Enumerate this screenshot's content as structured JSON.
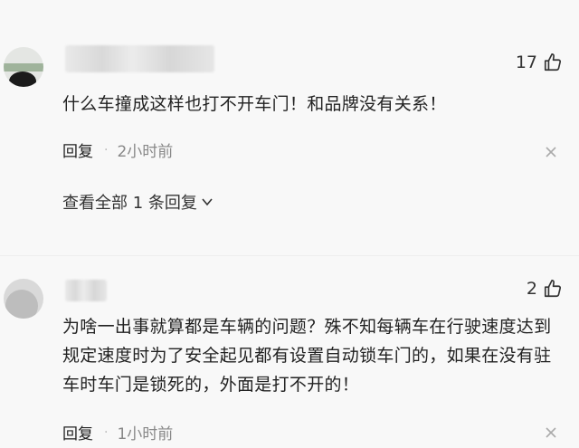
{
  "comments": [
    {
      "likes": "17",
      "text": "什么车撞成这样也打不开车门！和品牌没有关系！",
      "reply_label": "回复",
      "separator": "·",
      "time": "2小时前",
      "view_all": "查看全部 1 条回复"
    },
    {
      "likes": "2",
      "text": "为啥一出事就算都是车辆的问题？殊不知每辆车在行驶速度达到规定速度时为了安全起见都有设置自动锁车门的，如果在没有驻车时车门是锁死的，外面是打不开的！",
      "reply_label": "回复",
      "separator": "·",
      "time": "1小时前"
    }
  ],
  "icons": {
    "like": "thumbs-up-icon",
    "more": "close-icon",
    "expand": "chevron-down-icon"
  }
}
